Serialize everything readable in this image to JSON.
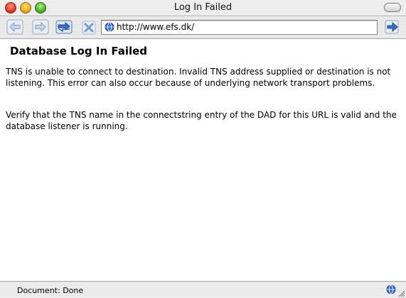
{
  "window": {
    "title": "Log In Failed"
  },
  "toolbar": {
    "back": "back-arrow-icon",
    "forward": "forward-arrow-icon",
    "reload": "reload-icon",
    "stop": "stop-icon",
    "go": "go-arrow-icon"
  },
  "address": {
    "url": "http://www.efs.dk/"
  },
  "content": {
    "heading": "Database Log In Failed",
    "paragraph1": "TNS is unable to connect to destination. Invalid TNS address supplied or destination is not listening. This error can also occur because of underlying network transport problems.",
    "paragraph2": "Verify that the TNS name in the connectstring entry of the DAD for this URL is valid and the database listener is running."
  },
  "status": {
    "text": "Document: Done"
  },
  "colors": {
    "accent": "#3a6fc4",
    "stop": "#7a9cc8"
  }
}
